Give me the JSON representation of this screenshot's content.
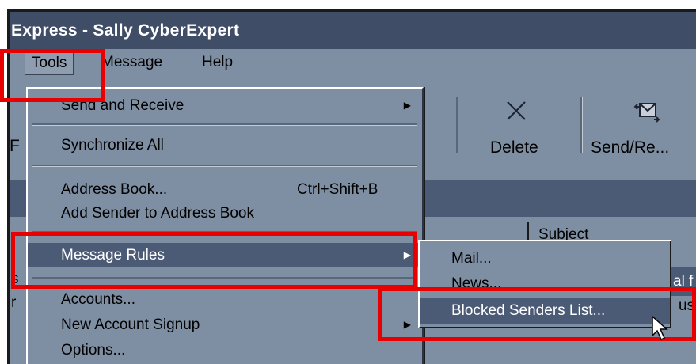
{
  "window": {
    "title": "Express - Sally CyberExpert"
  },
  "menubar": {
    "items": [
      {
        "label": "Tools",
        "mnemonic_index": 0
      },
      {
        "label": "Message",
        "mnemonic_index": 0
      },
      {
        "label": "Help",
        "mnemonic_index": 0
      }
    ]
  },
  "toolbar": {
    "buttons": [
      {
        "label": "Delete",
        "icon": "delete-x-icon"
      },
      {
        "label": "Send/Re...",
        "icon": "send-receive-icon"
      }
    ],
    "left_peek": "F"
  },
  "message_list": {
    "subject_header": "Subject",
    "peek_left_1": "s",
    "peek_left_2": "r",
    "peek_right_1": "al f",
    "peek_right_2": "us'"
  },
  "tools_menu": {
    "items": [
      {
        "label": "Send and Receive",
        "shortcut": "",
        "submenu": true
      },
      {
        "label": "Synchronize All",
        "shortcut": "",
        "submenu": false
      },
      {
        "label": "Address Book...",
        "shortcut": "Ctrl+Shift+B",
        "submenu": false
      },
      {
        "label": "Add Sender to Address Book",
        "shortcut": "",
        "submenu": false
      },
      {
        "label": "Message Rules",
        "shortcut": "",
        "submenu": true,
        "highlighted": true
      },
      {
        "label": "Accounts...",
        "shortcut": "",
        "submenu": false
      },
      {
        "label": "New Account Signup",
        "shortcut": "",
        "submenu": true
      },
      {
        "label": "Options...",
        "shortcut": "",
        "submenu": false
      }
    ]
  },
  "message_rules_submenu": {
    "items": [
      {
        "label": "Mail..."
      },
      {
        "label": "News..."
      },
      {
        "label": "Blocked Senders List...",
        "highlighted": true
      }
    ]
  },
  "colors": {
    "callout": "#e80000",
    "titlebar": "#3f4d66",
    "highlight": "#4b5a75",
    "surface": "#7f8fa3"
  }
}
